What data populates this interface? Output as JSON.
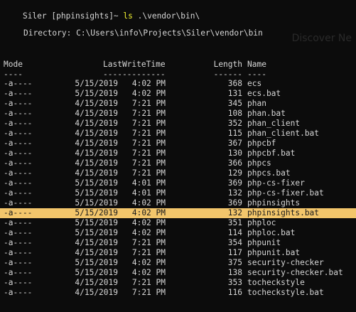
{
  "prompt": {
    "text": "Siler [phpinsights]~ ",
    "cmd": "ls",
    "arg": " .\\vendor\\bin\\"
  },
  "directory_line": "Directory: C:\\Users\\info\\Projects\\Siler\\vendor\\bin",
  "ghost_text": "Discover Ne",
  "headers": {
    "mode": "Mode",
    "lastwrite": "LastWriteTime",
    "length": "Length",
    "name": "Name"
  },
  "separators": {
    "mode": "----",
    "lastwrite": "-------------",
    "length": "------",
    "name": "----"
  },
  "rows": [
    {
      "mode": "-a----",
      "date": "5/15/2019",
      "time": "4:02 PM",
      "length": "368",
      "name": "ecs"
    },
    {
      "mode": "-a----",
      "date": "5/15/2019",
      "time": "4:02 PM",
      "length": "131",
      "name": "ecs.bat"
    },
    {
      "mode": "-a----",
      "date": "4/15/2019",
      "time": "7:21 PM",
      "length": "345",
      "name": "phan"
    },
    {
      "mode": "-a----",
      "date": "4/15/2019",
      "time": "7:21 PM",
      "length": "108",
      "name": "phan.bat"
    },
    {
      "mode": "-a----",
      "date": "4/15/2019",
      "time": "7:21 PM",
      "length": "352",
      "name": "phan_client"
    },
    {
      "mode": "-a----",
      "date": "4/15/2019",
      "time": "7:21 PM",
      "length": "115",
      "name": "phan_client.bat"
    },
    {
      "mode": "-a----",
      "date": "4/15/2019",
      "time": "7:21 PM",
      "length": "367",
      "name": "phpcbf"
    },
    {
      "mode": "-a----",
      "date": "4/15/2019",
      "time": "7:21 PM",
      "length": "130",
      "name": "phpcbf.bat"
    },
    {
      "mode": "-a----",
      "date": "4/15/2019",
      "time": "7:21 PM",
      "length": "366",
      "name": "phpcs"
    },
    {
      "mode": "-a----",
      "date": "4/15/2019",
      "time": "7:21 PM",
      "length": "129",
      "name": "phpcs.bat"
    },
    {
      "mode": "-a----",
      "date": "5/15/2019",
      "time": "4:01 PM",
      "length": "369",
      "name": "php-cs-fixer"
    },
    {
      "mode": "-a----",
      "date": "5/15/2019",
      "time": "4:01 PM",
      "length": "132",
      "name": "php-cs-fixer.bat"
    },
    {
      "mode": "-a----",
      "date": "5/15/2019",
      "time": "4:02 PM",
      "length": "369",
      "name": "phpinsights"
    },
    {
      "mode": "-a----",
      "date": "5/15/2019",
      "time": "4:02 PM",
      "length": "132",
      "name": "phpinsights.bat",
      "highlighted": true
    },
    {
      "mode": "-a----",
      "date": "5/15/2019",
      "time": "4:02 PM",
      "length": "351",
      "name": "phploc"
    },
    {
      "mode": "-a----",
      "date": "5/15/2019",
      "time": "4:02 PM",
      "length": "114",
      "name": "phploc.bat"
    },
    {
      "mode": "-a----",
      "date": "4/15/2019",
      "time": "7:21 PM",
      "length": "354",
      "name": "phpunit"
    },
    {
      "mode": "-a----",
      "date": "4/15/2019",
      "time": "7:21 PM",
      "length": "117",
      "name": "phpunit.bat"
    },
    {
      "mode": "-a----",
      "date": "5/15/2019",
      "time": "4:02 PM",
      "length": "375",
      "name": "security-checker"
    },
    {
      "mode": "-a----",
      "date": "5/15/2019",
      "time": "4:02 PM",
      "length": "138",
      "name": "security-checker.bat"
    },
    {
      "mode": "-a----",
      "date": "4/15/2019",
      "time": "7:21 PM",
      "length": "353",
      "name": "tocheckstyle"
    },
    {
      "mode": "-a----",
      "date": "4/15/2019",
      "time": "7:21 PM",
      "length": "116",
      "name": "tocheckstyle.bat"
    }
  ],
  "colors": {
    "background": "#0c0c0c",
    "text": "#d6d6d6",
    "command": "#f2f230",
    "highlight": "#f3c66b"
  }
}
